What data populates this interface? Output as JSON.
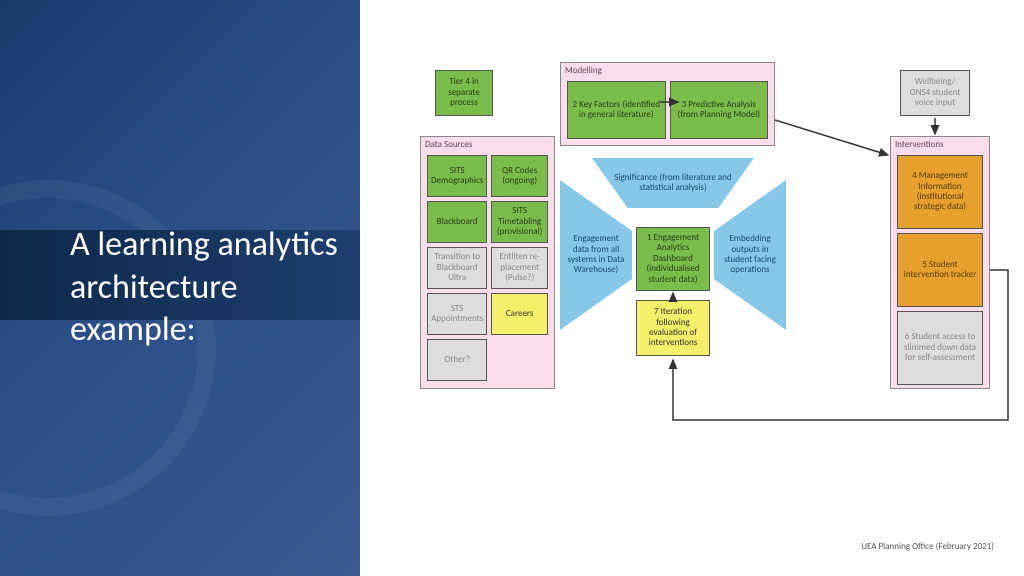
{
  "title": "A learning analytics architecture example:",
  "tier4": "Tier 4 in separate process",
  "wellbeing": "Wellbeing/ ONS4 student voice input",
  "panels": {
    "dataSources": {
      "label": "Data Sources",
      "items": [
        {
          "t": "SITS Demographics",
          "c": "green"
        },
        {
          "t": "QR Codes (ongoing)",
          "c": "green"
        },
        {
          "t": "Blackboard",
          "c": "green"
        },
        {
          "t": "SITS Timetabling (provisional)",
          "c": "green"
        },
        {
          "t": "Transition to Blackboard Ultra",
          "c": "greytext"
        },
        {
          "t": "Entliten re-placement (Pulse?)",
          "c": "greytext"
        },
        {
          "t": "STS Appointments",
          "c": "greytext"
        },
        {
          "t": "Careers",
          "c": "yellow"
        },
        {
          "t": "Other?",
          "c": "greytext"
        }
      ]
    },
    "modelling": {
      "label": "Modelling",
      "items": [
        {
          "t": "2\nKey Factors (identified in general literature)",
          "c": "green"
        },
        {
          "t": "3\nPredictive Analysis (from Planning Model)",
          "c": "green"
        }
      ]
    },
    "interventions": {
      "label": "Interventions",
      "items": [
        {
          "t": "4\nManagement Information (institutional strategic data)",
          "c": "orange"
        },
        {
          "t": "5\nStudent intervention tracker",
          "c": "orange"
        },
        {
          "t": "6\nStudent access to slimmed down data for self-assessment",
          "c": "greytext"
        }
      ]
    }
  },
  "center": {
    "significance": "Significance (from literature and statistical analysis)",
    "engagement": "Engagement data from all systems in Data Warehouse)",
    "embedding": "Embedding outputs in student facing operations",
    "dashboard": "1\nEngagement Analytics Dashboard (individualised student data)",
    "iteration": "7\nIteration following evaluation of interventions"
  },
  "credit": "UEA Planning Office (February 2021)"
}
